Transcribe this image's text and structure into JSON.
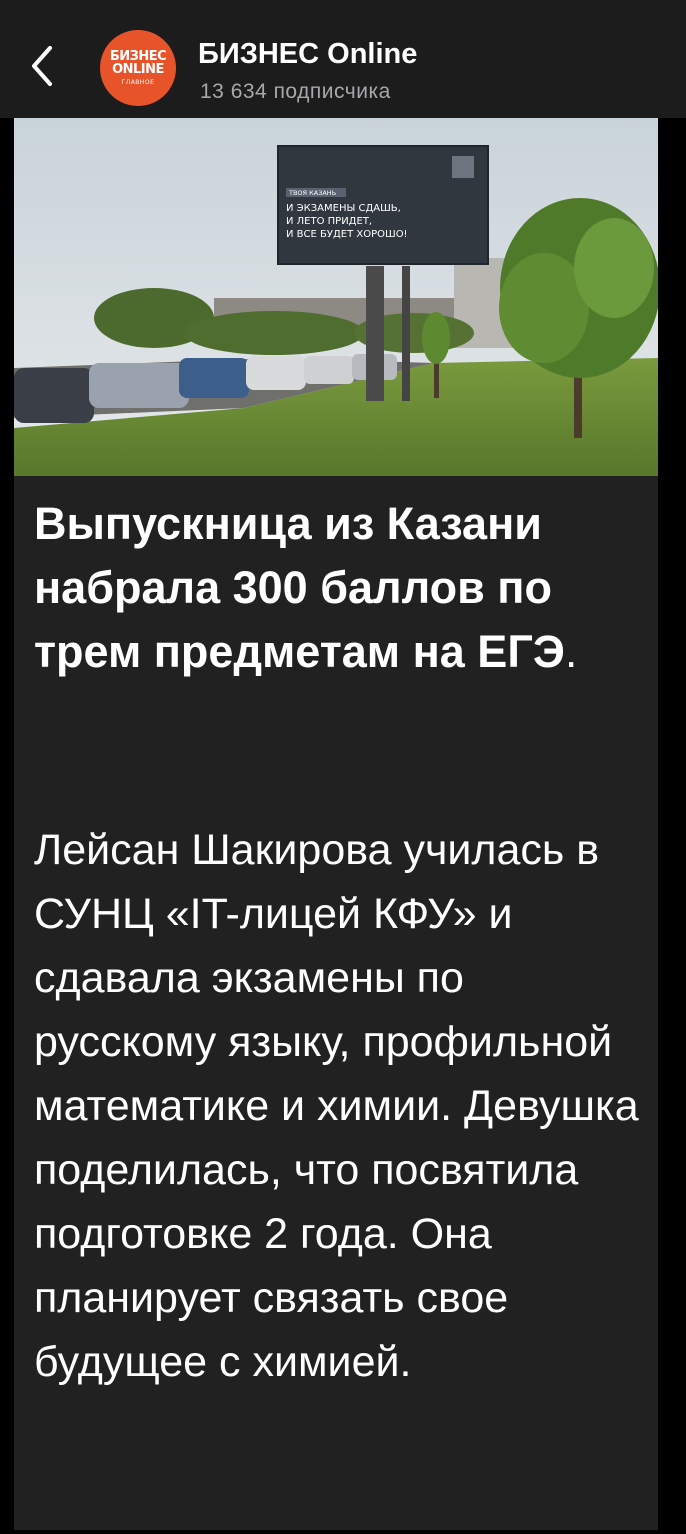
{
  "channel": {
    "name": "БИЗНЕС Online",
    "subscribers": "13 634 подписчика",
    "avatar": {
      "line1": "БИЗНЕС",
      "line2": "ONLINE",
      "line3": "ГЛАВНОЕ",
      "color": "#e8542a"
    }
  },
  "header": {
    "back_icon": "chevron-left-icon"
  },
  "post": {
    "photo": {
      "billboard": {
        "tag": "ТВОЯ КАЗАНЬ",
        "line1": "И ЭКЗАМЕНЫ СДАШЬ,",
        "line2": "И ЛЕТО ПРИДЕТ,",
        "line3": "И ВСЕ БУДЕТ ХОРОШО!"
      }
    },
    "headline": "Выпускница из Казани набрала 300 баллов по трем предметам на ЕГЭ",
    "headline_end": ".",
    "body": "Лейсан Шакирова училась в СУНЦ «IT-лицей КФУ» и сдавала экзамены по русскому языку, профильной математике и химии. Девушка поделилась, что посвятила подготовке 2 года. Она планирует связать свое будущее с химией."
  },
  "colors": {
    "background": "#000000",
    "header_bg": "#1c1c1d",
    "post_bg": "#212122",
    "secondary_text": "#a8a8ac"
  }
}
